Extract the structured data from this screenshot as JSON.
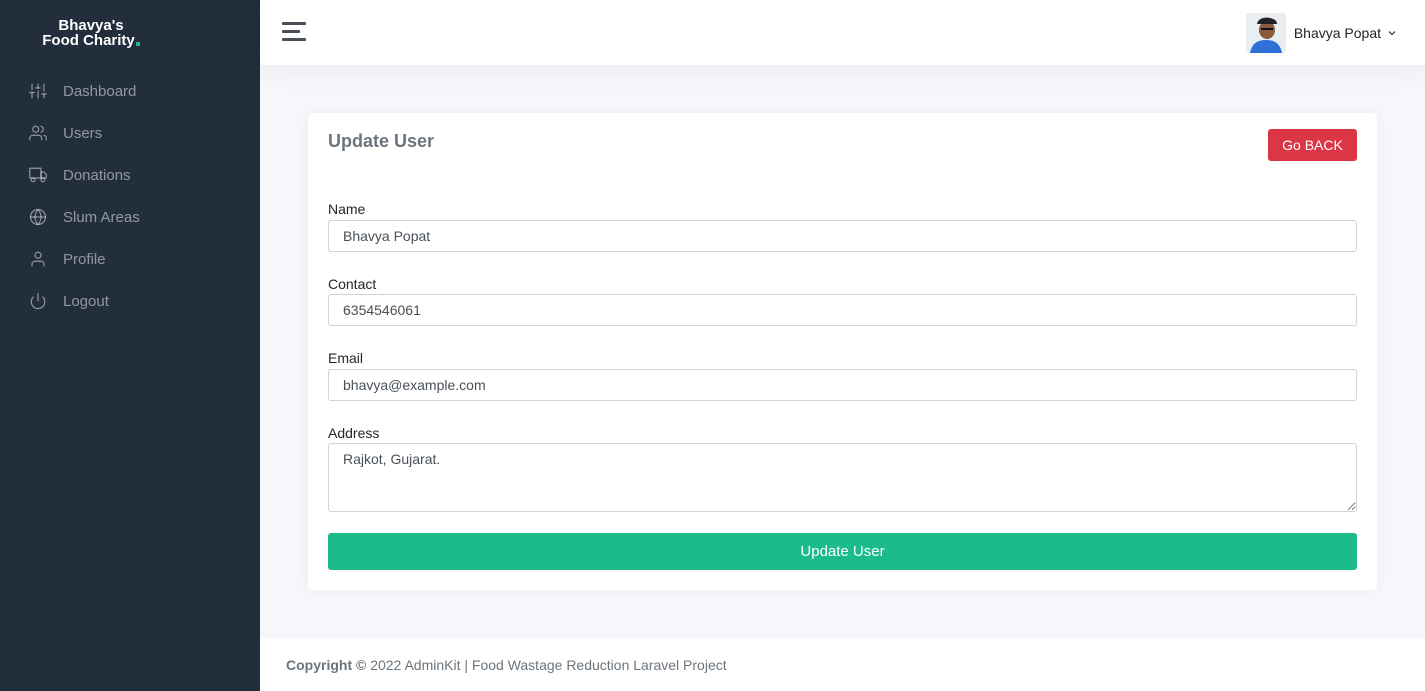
{
  "brand": {
    "line1": "Bhavya's",
    "line2": "Food Charity"
  },
  "sidebar": {
    "items": [
      {
        "label": "Dashboard",
        "icon": "sliders-icon"
      },
      {
        "label": "Users",
        "icon": "users-icon"
      },
      {
        "label": "Donations",
        "icon": "truck-icon"
      },
      {
        "label": "Slum Areas",
        "icon": "globe-icon"
      },
      {
        "label": "Profile",
        "icon": "user-icon"
      },
      {
        "label": "Logout",
        "icon": "power-icon"
      }
    ]
  },
  "topbar": {
    "username": "Bhavya Popat"
  },
  "form": {
    "title": "Update User",
    "back_label": "Go BACK",
    "name_label": "Name",
    "name_value": "Bhavya Popat",
    "contact_label": "Contact",
    "contact_value": "6354546061",
    "email_label": "Email",
    "email_value": "bhavya@example.com",
    "address_label": "Address",
    "address_value": "Rajkot, Gujarat.",
    "submit_label": "Update User"
  },
  "footer": {
    "copyright_label": "Copyright ©",
    "text": "2022 AdminKit | Food Wastage Reduction Laravel Project"
  },
  "colors": {
    "sidebar_bg": "#222e3c",
    "accent": "#1cbb8c",
    "danger": "#dc3545"
  }
}
